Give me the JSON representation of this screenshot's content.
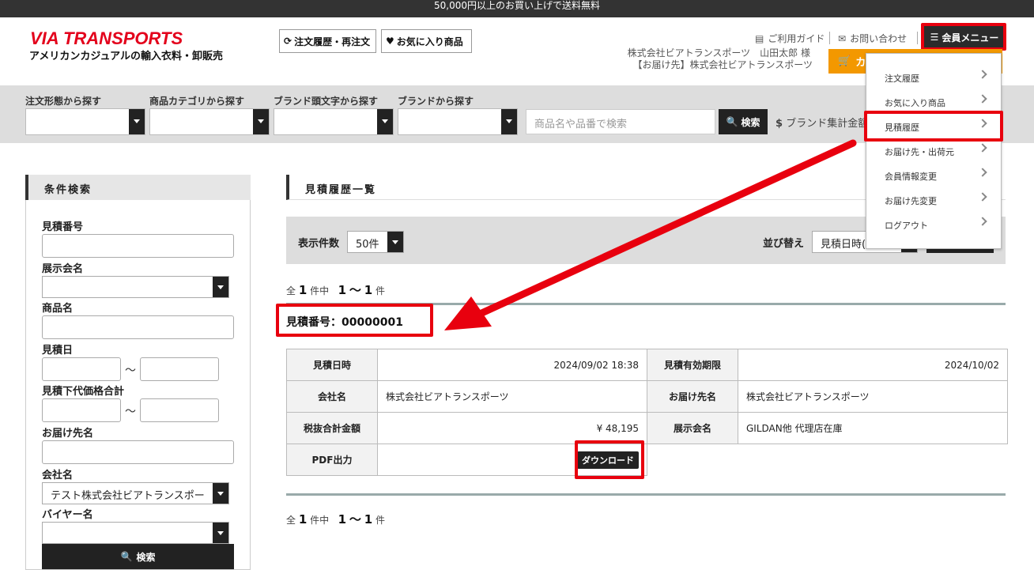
{
  "topbar": {
    "text": "50,000円以上のお買い上げで送料無料"
  },
  "header": {
    "logo": "VIA TRANSPORTS",
    "tagline": "アメリカンカジュアルの輸入衣料・卸販売",
    "order_history_btn": "注文履歴・再注文",
    "favorites_btn": "お気に入り商品",
    "guide_link": "ご利用ガイド",
    "contact_link": "お問い合わせ",
    "member_menu_btn": "会員メニュー",
    "user_line1": "株式会社ビアトランスポーツ　山田太郎 様",
    "user_line2": "【お届け先】株式会社ビアトランスポーツ",
    "cart_label": "カ"
  },
  "search": {
    "filter1_label": "注文形態から探す",
    "filter2_label": "商品カテゴリから探す",
    "filter3_label": "ブランド頭文字から探す",
    "filter4_label": "ブランドから探す",
    "placeholder": "商品名や品番で検索",
    "search_btn": "検索",
    "brand_total": "ブランド集計金額"
  },
  "sidebar": {
    "title": "条件検索",
    "quote_no": "見積番号",
    "exhibition": "展示会名",
    "product": "商品名",
    "quote_date": "見積日",
    "price_total": "見積下代価格合計",
    "destination": "お届け先名",
    "company": "会社名",
    "company_value": "テスト株式会社ビアトランスポー",
    "buyer": "バイヤー名",
    "tilde": "〜",
    "search_btn": "検索"
  },
  "main": {
    "title": "見積履歴一覧",
    "per_page_label": "表示件数",
    "per_page_value": "50件",
    "sort_label": "並び替え",
    "sort_value": "見積日時(",
    "count_all": "全",
    "count_total": "1",
    "count_unit": "件中",
    "count_from": "1",
    "count_sep": "〜",
    "count_to": "1",
    "count_unit2": "件",
    "quote_number": "見積番号：00000001"
  },
  "quote_table": {
    "quote_datetime_label": "見積日時",
    "quote_datetime": "2024/09/02 18:38",
    "valid_until_label": "見積有効期限",
    "valid_until": "2024/10/02",
    "company_label": "会社名",
    "company": "株式会社ビアトランスポーツ",
    "destination_label": "お届け先名",
    "destination": "株式会社ビアトランスポーツ",
    "total_label": "税抜合計金額",
    "total": "¥ 48,195",
    "exhibition_label": "展示会名",
    "exhibition": "GILDAN他 代理店在庫",
    "pdf_label": "PDF出力",
    "download_btn": "ダウンロード"
  },
  "member_menu": {
    "items": [
      "注文履歴",
      "お気に入り商品",
      "見積履歴",
      "お届け先・出荷元",
      "会員情報変更",
      "お届け先変更",
      "ログアウト"
    ]
  },
  "colors": {
    "highlight": "#e8000e",
    "brand_red": "#e3001b",
    "cart": "#f39800"
  }
}
